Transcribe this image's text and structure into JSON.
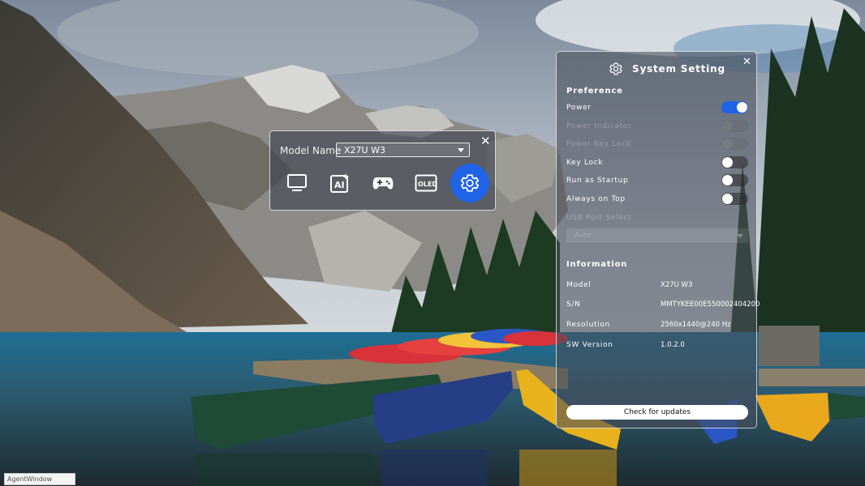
{
  "model_popup": {
    "label": "Model Name",
    "selected_model": "X27U W3",
    "icons": [
      "monitor-icon",
      "ai-icon",
      "gamepad-icon",
      "oled-icon",
      "gear-icon"
    ],
    "oled_text": "OLED",
    "ai_text": "AI",
    "active_icon": "gear-icon"
  },
  "system_setting": {
    "title": "System Setting",
    "preference_heading": "Preference",
    "preferences": [
      {
        "label": "Power",
        "state": "on",
        "enabled": true
      },
      {
        "label": "Power Indicator",
        "state": "off",
        "enabled": false
      },
      {
        "label": "Power Key Lock",
        "state": "off",
        "enabled": false
      },
      {
        "label": "Key Lock",
        "state": "off",
        "enabled": true
      },
      {
        "label": "Run as Startup",
        "state": "off",
        "enabled": true
      },
      {
        "label": "Always on Top",
        "state": "off",
        "enabled": true
      }
    ],
    "usb_label": "USB Port Select",
    "usb_value": "Auto",
    "information_heading": "Information",
    "info": [
      {
        "key": "Model",
        "value": "X27U W3"
      },
      {
        "key": "S/N",
        "value": "MMTYKEE00E550002404200"
      },
      {
        "key": "Resolution",
        "value": "2560x1440@240 Hz"
      },
      {
        "key": "SW Version",
        "value": "1.0.2.0"
      }
    ],
    "update_button": "Check for updates"
  },
  "taskbar": {
    "item": "AgentWindow"
  },
  "colors": {
    "accent": "#1f63e6",
    "panel": "#484e5a"
  }
}
